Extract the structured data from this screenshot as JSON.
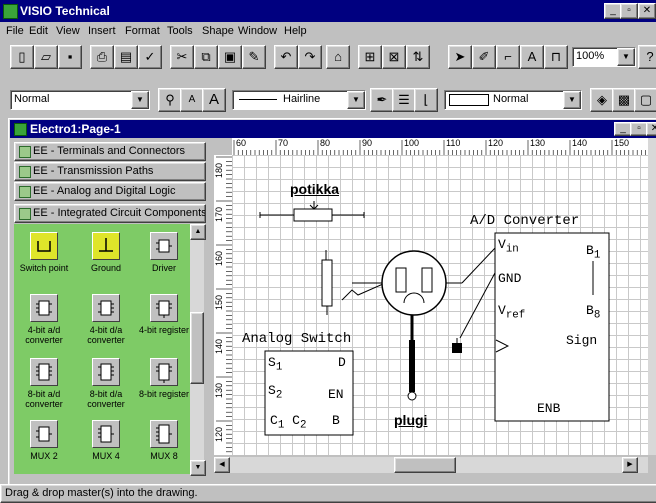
{
  "app": {
    "title": "VISIO Technical"
  },
  "window_buttons": {
    "minimize": "_",
    "restore": "▫",
    "close": "✕"
  },
  "menu": [
    "File",
    "Edit",
    "View",
    "Insert",
    "Format",
    "Tools",
    "Shape",
    "Window",
    "Help"
  ],
  "format_bar": {
    "style": "Normal",
    "line_weight": "Hairline",
    "fill_pattern": "Normal"
  },
  "standard_bar": {
    "zoom": "100%"
  },
  "document": {
    "title": "Electro1:Page-1"
  },
  "stencils": [
    {
      "label": "EE - Terminals and Connectors"
    },
    {
      "label": "EE - Transmission Paths"
    },
    {
      "label": "EE - Analog and Digital Logic"
    },
    {
      "label": "EE - Integrated Circuit Components"
    }
  ],
  "masters": [
    {
      "label": "Switch point",
      "icon": "switch-point-icon"
    },
    {
      "label": "Ground",
      "icon": "ground-icon"
    },
    {
      "label": "Driver",
      "icon": "driver-icon"
    },
    {
      "label": "4-bit a/d converter",
      "icon": "chip-icon"
    },
    {
      "label": "4-bit d/a converter",
      "icon": "chip-icon"
    },
    {
      "label": "4-bit register",
      "icon": "chip-icon"
    },
    {
      "label": "8-bit a/d converter",
      "icon": "chip-icon"
    },
    {
      "label": "8-bit d/a converter",
      "icon": "chip-icon"
    },
    {
      "label": "8-bit register",
      "icon": "chip-icon"
    },
    {
      "label": "MUX 2",
      "icon": "chip-icon"
    },
    {
      "label": "MUX 4",
      "icon": "chip-icon"
    },
    {
      "label": "MUX 8",
      "icon": "chip-icon"
    }
  ],
  "ruler": {
    "h_ticks": [
      "60",
      "70",
      "80",
      "90",
      "100",
      "110",
      "120",
      "130",
      "140",
      "150"
    ],
    "v_ticks": [
      "180",
      "170",
      "160",
      "150",
      "140",
      "130",
      "120"
    ]
  },
  "drawing": {
    "potikka": "potikka",
    "plugi": "plugi",
    "analog_switch": {
      "title": "Analog Switch",
      "s1": "S",
      "s1_sub": "1",
      "s2": "S",
      "s2_sub": "2",
      "d": "D",
      "en": "EN",
      "c1": "C",
      "c1_sub": "1",
      "c2": "C",
      "c2_sub": "2",
      "b": "B"
    },
    "ad_converter": {
      "title": "A/D Converter",
      "vin": "V",
      "vin_sub": "in",
      "gnd": "GND",
      "vref": "V",
      "vref_sub": "ref",
      "b1": "B",
      "b1_sub": "1",
      "b8": "B",
      "b8_sub": "8",
      "sign": "Sign",
      "enb": "ENB"
    }
  },
  "status": "Drag & drop master(s) into the drawing."
}
